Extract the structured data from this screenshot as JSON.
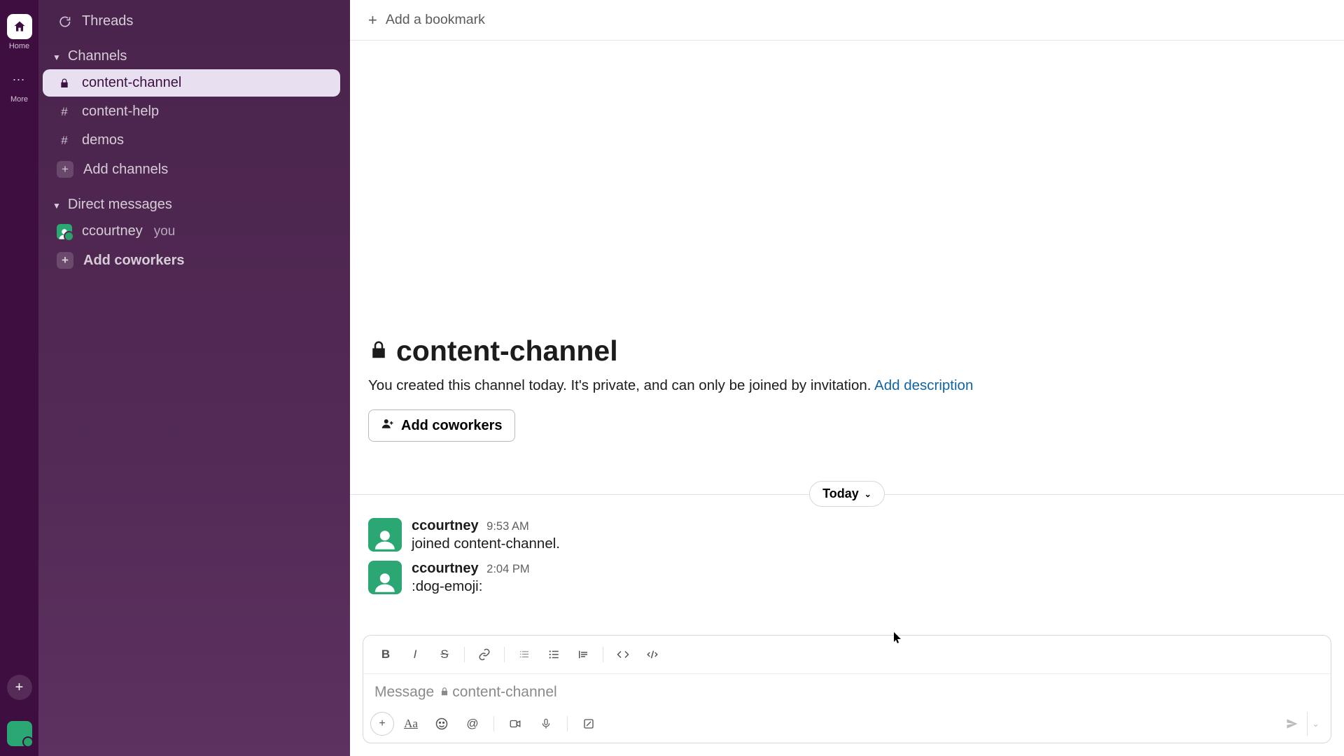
{
  "rail": {
    "home": "Home",
    "more": "More"
  },
  "sidebar": {
    "threads": "Threads",
    "channels_header": "Channels",
    "channels": [
      {
        "name": "content-channel",
        "icon": "lock",
        "active": true
      },
      {
        "name": "content-help",
        "icon": "hash",
        "active": false
      },
      {
        "name": "demos",
        "icon": "hash",
        "active": false
      }
    ],
    "add_channels": "Add channels",
    "dm_header": "Direct messages",
    "dm_self_name": "ccourtney",
    "dm_self_tag": "you",
    "add_coworkers": "Add coworkers"
  },
  "bookmark": {
    "add": "Add a bookmark"
  },
  "channel": {
    "name": "content-channel",
    "intro": "You created this channel today. It's private, and can only be joined by invitation. ",
    "add_description": "Add description",
    "add_coworkers": "Add coworkers"
  },
  "date_pill": "Today",
  "messages": [
    {
      "user": "ccourtney",
      "time": "9:53 AM",
      "body": "joined content-channel."
    },
    {
      "user": "ccourtney",
      "time": "2:04 PM",
      "body": ":dog-emoji:"
    }
  ],
  "composer": {
    "placeholder_prefix": "Message ",
    "placeholder_channel": "content-channel"
  }
}
